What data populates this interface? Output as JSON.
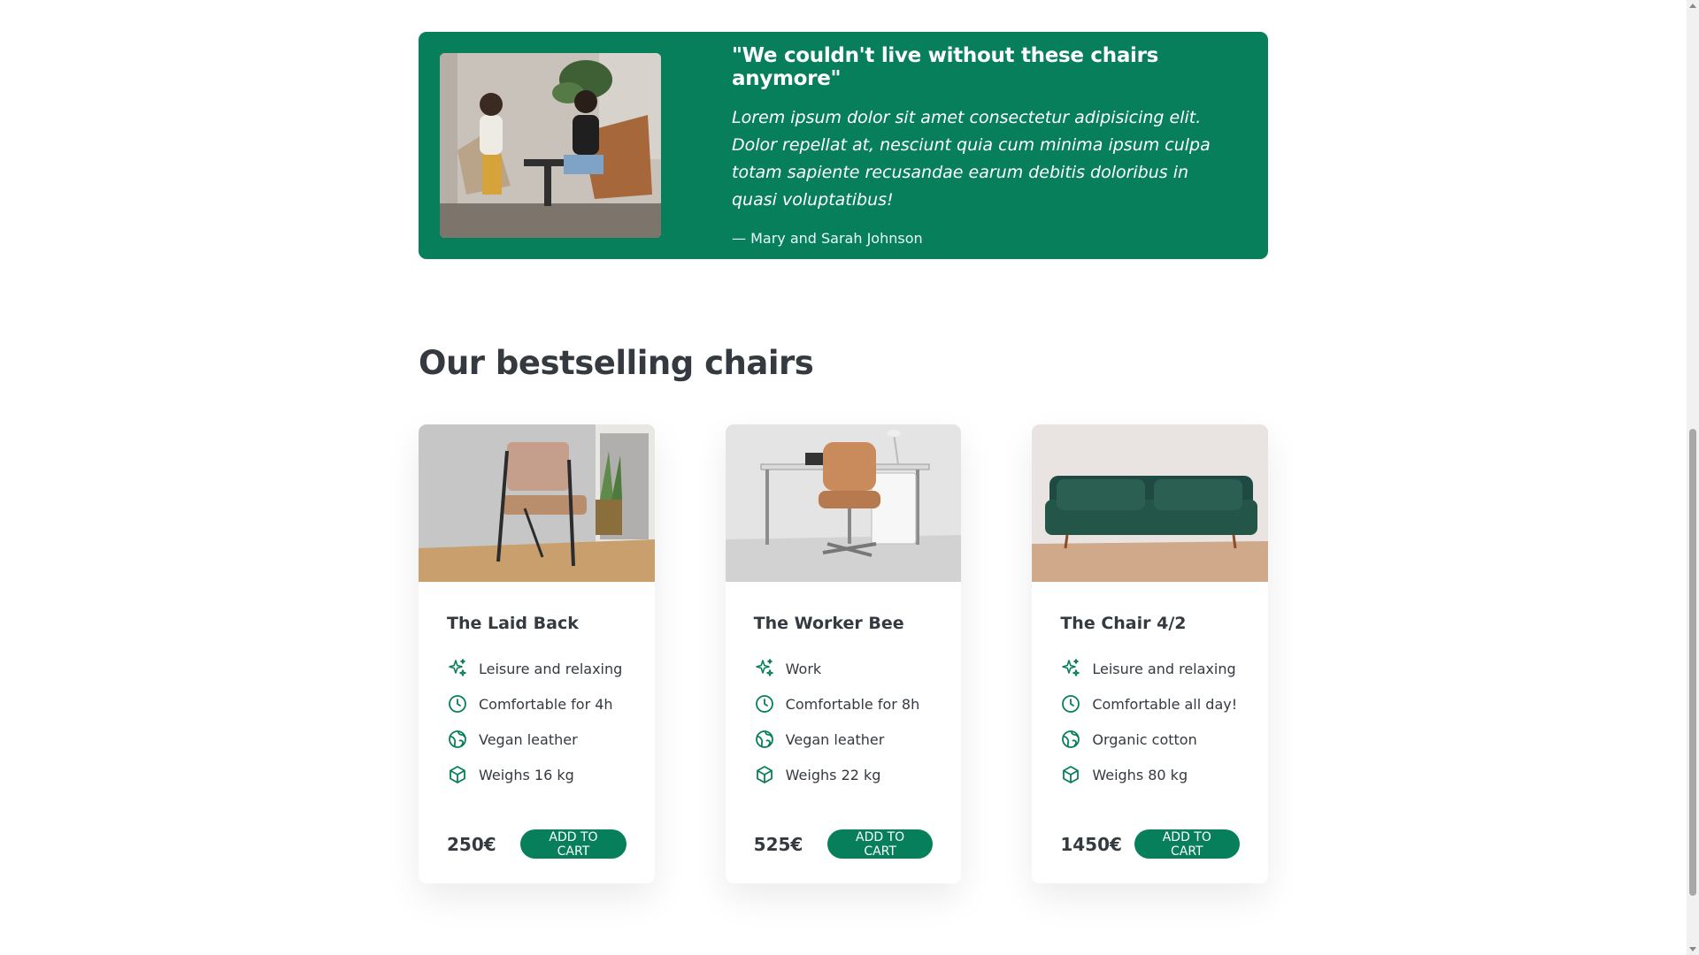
{
  "testimonial": {
    "title": "\"We couldn't live without these chairs anymore\"",
    "quote": "Lorem ipsum dolor sit amet consectetur adipisicing elit. Dolor repellat at, nesciunt quia cum minima ipsum culpa totam sapiente recusandae earum debitis doloribus in quasi voluptatibus!",
    "author": "— Mary and Sarah Johnson"
  },
  "section": {
    "title": "Our bestselling chairs"
  },
  "products": [
    {
      "name": "The Laid Back",
      "features": [
        "Leisure and relaxing",
        "Comfortable for 4h",
        "Vegan leather",
        "Weighs 16 kg"
      ],
      "price": "250€",
      "button": "ADD TO CART"
    },
    {
      "name": "The Worker Bee",
      "features": [
        "Work",
        "Comfortable for 8h",
        "Vegan leather",
        "Weighs 22 kg"
      ],
      "price": "525€",
      "button": "ADD TO CART"
    },
    {
      "name": "The Chair 4/2",
      "features": [
        "Leisure and relaxing",
        "Comfortable all day!",
        "Organic cotton",
        "Weighs 80 kg"
      ],
      "price": "1450€",
      "button": "ADD TO CART"
    }
  ],
  "icons": [
    "sparkles-icon",
    "clock-icon",
    "globe-icon",
    "cube-icon"
  ],
  "colors": {
    "accent": "#087f5b",
    "text": "#343a40"
  }
}
